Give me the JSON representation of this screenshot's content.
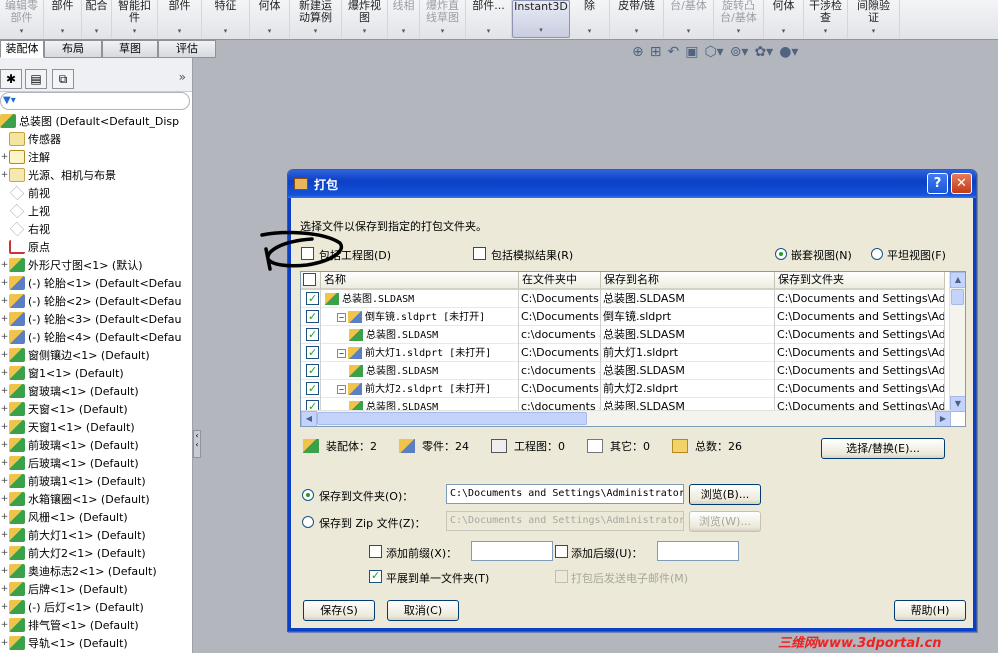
{
  "ribbon": {
    "buttons": [
      {
        "label": "编辑零\n部件",
        "disabled": true,
        "w": 44
      },
      {
        "label": "部件",
        "disabled": false,
        "w": 38
      },
      {
        "label": "配合",
        "disabled": false,
        "w": 30
      },
      {
        "label": "智能扣\n件",
        "disabled": false,
        "w": 46
      },
      {
        "label": "部件",
        "disabled": false,
        "w": 44
      },
      {
        "label": "特征",
        "disabled": false,
        "w": 48
      },
      {
        "label": "何体",
        "disabled": false,
        "w": 40
      },
      {
        "label": "新建运\n动算例",
        "disabled": false,
        "w": 52
      },
      {
        "label": "爆炸视\n图",
        "disabled": false,
        "w": 46
      },
      {
        "label": "线相",
        "disabled": true,
        "w": 32
      },
      {
        "label": "爆炸直\n线草图",
        "disabled": true,
        "w": 46
      },
      {
        "label": "部件...",
        "disabled": false,
        "w": 46
      },
      {
        "label": "Instant3D",
        "disabled": false,
        "w": 58,
        "active": true
      },
      {
        "label": "除",
        "disabled": false,
        "w": 40
      },
      {
        "label": "皮带/链",
        "disabled": false,
        "w": 54
      },
      {
        "label": "台/基体",
        "disabled": true,
        "w": 50
      },
      {
        "label": "旋转凸\n台/基体",
        "disabled": true,
        "w": 50
      },
      {
        "label": "何体",
        "disabled": false,
        "w": 40
      },
      {
        "label": "干涉检\n查",
        "disabled": false,
        "w": 44
      },
      {
        "label": "间隙验\n证",
        "disabled": false,
        "w": 52
      }
    ]
  },
  "tabs": [
    "装配体",
    "布局",
    "草图",
    "评估"
  ],
  "tree": {
    "root": "总装图  (Default<Default_Disp",
    "items": [
      {
        "label": "传感器",
        "icon": "sensor",
        "exp": ""
      },
      {
        "label": "注解",
        "icon": "note",
        "exp": "+"
      },
      {
        "label": "光源、相机与布景",
        "icon": "light",
        "exp": "+"
      },
      {
        "label": "前视",
        "icon": "plane",
        "exp": ""
      },
      {
        "label": "上视",
        "icon": "plane",
        "exp": ""
      },
      {
        "label": "右视",
        "icon": "plane",
        "exp": ""
      },
      {
        "label": "原点",
        "icon": "origin",
        "exp": ""
      },
      {
        "label": "外形尺寸图<1> (默认)",
        "icon": "asm",
        "exp": "+"
      },
      {
        "label": "(-) 轮胎<1> (Default<Defau",
        "icon": "part",
        "exp": "+"
      },
      {
        "label": "(-) 轮胎<2> (Default<Defau",
        "icon": "part",
        "exp": "+"
      },
      {
        "label": "(-) 轮胎<3> (Default<Defau",
        "icon": "part",
        "exp": "+"
      },
      {
        "label": "(-) 轮胎<4> (Default<Defau",
        "icon": "part",
        "exp": "+"
      },
      {
        "label": "窗侧镶边<1> (Default)",
        "icon": "asm",
        "exp": "+"
      },
      {
        "label": "窗1<1> (Default)",
        "icon": "asm",
        "exp": "+"
      },
      {
        "label": "窗玻璃<1> (Default)",
        "icon": "asm",
        "exp": "+"
      },
      {
        "label": "天窗<1> (Default)",
        "icon": "asm",
        "exp": "+"
      },
      {
        "label": "天窗1<1> (Default)",
        "icon": "asm",
        "exp": "+"
      },
      {
        "label": "前玻璃<1> (Default)",
        "icon": "asm",
        "exp": "+"
      },
      {
        "label": "后玻璃<1> (Default)",
        "icon": "asm",
        "exp": "+"
      },
      {
        "label": "前玻璃1<1> (Default)",
        "icon": "asm",
        "exp": "+"
      },
      {
        "label": "水箱镶圈<1> (Default)",
        "icon": "asm",
        "exp": "+"
      },
      {
        "label": "风栅<1> (Default)",
        "icon": "asm",
        "exp": "+"
      },
      {
        "label": "前大灯1<1> (Default)",
        "icon": "asm",
        "exp": "+"
      },
      {
        "label": "前大灯2<1> (Default)",
        "icon": "asm",
        "exp": "+"
      },
      {
        "label": "奥迪标志2<1> (Default)",
        "icon": "asm",
        "exp": "+"
      },
      {
        "label": "后牌<1> (Default)",
        "icon": "asm",
        "exp": "+"
      },
      {
        "label": "(-) 后灯<1> (Default)",
        "icon": "asm",
        "exp": "+"
      },
      {
        "label": "排气管<1> (Default)",
        "icon": "asm",
        "exp": "+"
      },
      {
        "label": "导轨<1> (Default)",
        "icon": "asm",
        "exp": "+"
      }
    ]
  },
  "dialog": {
    "title": "打包",
    "help_btn": "?",
    "close_btn": "✕",
    "instruction": "选择文件以保存到指定的打包文件夹。",
    "include_drawings": "包括工程图(D)",
    "include_sim": "包括模拟结果(R)",
    "nested_view": "嵌套视图(N)",
    "flat_view": "平坦视图(F)",
    "columns": [
      "名称",
      "在文件夹中",
      "保存到名称",
      "保存到文件夹"
    ],
    "rows": [
      {
        "name": "总装图.SLDASM",
        "indent": 0,
        "minus": false,
        "folder": "C:\\Documents a",
        "savename": "总装图.SLDASM",
        "savefolder": "C:\\Documents and Settings\\Admin"
      },
      {
        "name": "倒车镜.sldprt [未打开]",
        "indent": 1,
        "minus": true,
        "folder": "C:\\Documents a",
        "savename": "倒车镜.sldprt",
        "savefolder": "C:\\Documents and Settings\\Admin"
      },
      {
        "name": "总装图.SLDASM",
        "indent": 2,
        "minus": false,
        "folder": "c:\\documents a",
        "savename": "总装图.SLDASM",
        "savefolder": "C:\\Documents and Settings\\Admin"
      },
      {
        "name": "前大灯1.sldprt [未打开]",
        "indent": 1,
        "minus": true,
        "folder": "C:\\Documents a",
        "savename": "前大灯1.sldprt",
        "savefolder": "C:\\Documents and Settings\\Admin"
      },
      {
        "name": "总装图.SLDASM",
        "indent": 2,
        "minus": false,
        "folder": "c:\\documents a",
        "savename": "总装图.SLDASM",
        "savefolder": "C:\\Documents and Settings\\Admin"
      },
      {
        "name": "前大灯2.sldprt [未打开]",
        "indent": 1,
        "minus": true,
        "folder": "C:\\Documents a",
        "savename": "前大灯2.sldprt",
        "savefolder": "C:\\Documents and Settings\\Admin"
      },
      {
        "name": "总装图.SLDASM",
        "indent": 2,
        "minus": false,
        "folder": "c:\\documents a",
        "savename": "总装图.SLDASM",
        "savefolder": "C:\\Documents and Settings\\Admin"
      }
    ],
    "stats": {
      "assemblies": "装配体：2",
      "parts": "零件：24",
      "drawings": "工程图：0",
      "other": "其它：0",
      "total": "总数：26"
    },
    "select_replace": "选择/替换(E)...",
    "save_to_folder": "保存到文件夹(O)：",
    "save_to_zip": "保存到 Zip 文件(Z)：",
    "folder_path": "C:\\Documents and Settings\\Administrator",
    "zip_path": "C:\\Documents and Settings\\Administrator",
    "browse1": "浏览(B)...",
    "browse2": "浏览(W)...",
    "add_prefix": "添加前缀(X)：",
    "add_suffix": "添加后缀(U)：",
    "flatten": "平展到单一文件夹(T)",
    "email": "打包后发送电子邮件(M)",
    "save_btn": "保存(S)",
    "cancel_btn": "取消(C)",
    "help": "帮助(H)"
  },
  "watermark": "三维网www.3dportal.cn"
}
